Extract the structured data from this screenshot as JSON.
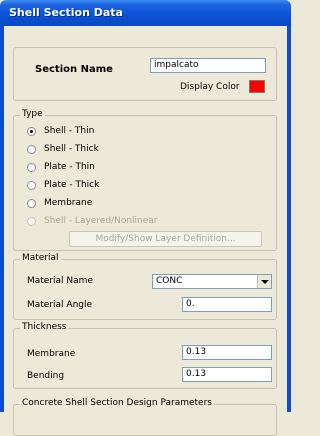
{
  "window": {
    "title": "Shell Section Data"
  },
  "section": {
    "name_label": "Section Name",
    "name_value": "impalcato",
    "display_color_label": "Display Color",
    "display_color": "#ff0000"
  },
  "type_group": {
    "legend": "Type",
    "options": [
      {
        "label": "Shell - Thin",
        "selected": true,
        "enabled": true
      },
      {
        "label": "Shell - Thick",
        "selected": false,
        "enabled": true
      },
      {
        "label": "Plate - Thin",
        "selected": false,
        "enabled": true
      },
      {
        "label": "Plate - Thick",
        "selected": false,
        "enabled": true
      },
      {
        "label": "Membrane",
        "selected": false,
        "enabled": true
      },
      {
        "label": "Shell - Layered/Nonlinear",
        "selected": false,
        "enabled": false
      }
    ],
    "layer_button_label": "Modify/Show Layer Definition..."
  },
  "material_group": {
    "legend": "Material",
    "name_label": "Material Name",
    "name_value": "CONC",
    "angle_label": "Material Angle",
    "angle_value": "0."
  },
  "thickness_group": {
    "legend": "Thickness",
    "membrane_label": "Membrane",
    "membrane_value": "0.13",
    "bending_label": "Bending",
    "bending_value": "0.13"
  },
  "concrete_group": {
    "legend": "Concrete Shell Section Design Parameters"
  }
}
